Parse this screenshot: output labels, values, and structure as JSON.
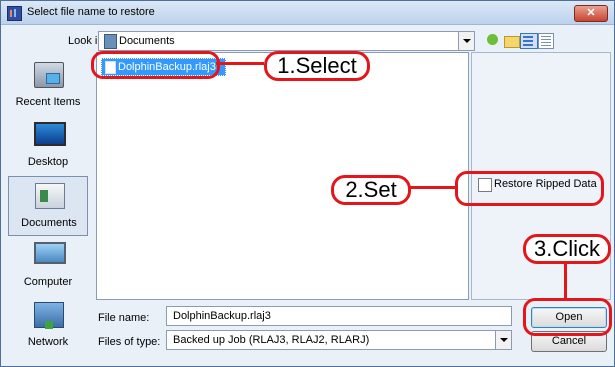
{
  "window": {
    "title": "Select file name to restore",
    "close_label": "✕"
  },
  "toolbar": {
    "look_in_label": "Look in:",
    "look_in_value": "Documents"
  },
  "places": [
    {
      "label": "Recent Items"
    },
    {
      "label": "Desktop"
    },
    {
      "label": "Documents"
    },
    {
      "label": "Computer"
    },
    {
      "label": "Network"
    }
  ],
  "files": [
    {
      "name": "DolphinBackup.rlaj3"
    }
  ],
  "options": {
    "restore_ripped_label": "Restore Ripped Data",
    "restore_ripped_checked": false
  },
  "form": {
    "file_name_label": "File name:",
    "file_name_value": "DolphinBackup.rlaj3",
    "file_type_label": "Files of type:",
    "file_type_value": "Backed up Job (RLAJ3, RLAJ2, RLARJ)"
  },
  "buttons": {
    "open": "Open",
    "cancel": "Cancel"
  },
  "annotations": {
    "step1": "1.Select",
    "step2": "2.Set",
    "step3": "3.Click",
    "color": "#e3161b"
  }
}
